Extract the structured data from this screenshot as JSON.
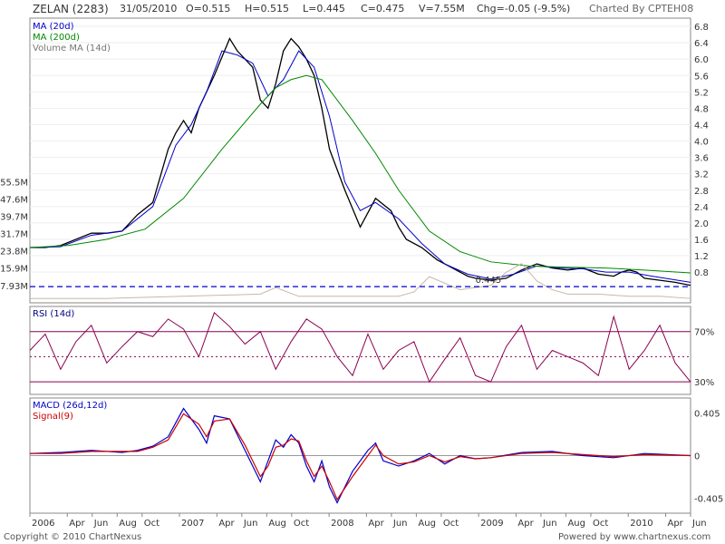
{
  "header": {
    "symbol": "ZELAN (2283)",
    "date": "31/05/2010",
    "open": "O=0.515",
    "high": "H=0.515",
    "low": "L=0.445",
    "close": "C=0.475",
    "volume": "V=7.55M",
    "change": "Chg=-0.05 (-9.5%)",
    "charted_by": "Charted By CPTEH08"
  },
  "footer": {
    "copyright": "Copyright © 2010 ChartNexus",
    "powered": "Powered by www.chartnexus.com"
  },
  "colors": {
    "price": "#000000",
    "ma20": "#0000cc",
    "ma200": "#008800",
    "volume": "#c8b8a8",
    "rsi": "#8b0050",
    "macd": "#0000cc",
    "signal": "#cc0000",
    "support": "#0000cc"
  },
  "chart_data": [
    {
      "type": "line",
      "panel": "price",
      "legend": [
        "MA (20d)",
        "MA (200d)",
        "Volume MA (14d)"
      ],
      "y_ticks": [
        "6.8",
        "6.4",
        "6.0",
        "5.6",
        "5.2",
        "4.8",
        "4.4",
        "4.0",
        "3.6",
        "3.2",
        "2.8",
        "2.4",
        "2.0",
        "1.6",
        "1.2",
        "0.8"
      ],
      "y_tick_values": [
        6.8,
        6.4,
        6.0,
        5.6,
        5.2,
        4.8,
        4.4,
        4.0,
        3.6,
        3.2,
        2.8,
        2.4,
        2.0,
        1.6,
        1.2,
        0.8
      ],
      "volume_ticks": [
        "55.5M",
        "47.6M",
        "39.7M",
        "31.7M",
        "23.8M",
        "15.9M",
        "7.93M"
      ],
      "volume_tick_values": [
        55.5,
        47.6,
        39.7,
        31.7,
        23.8,
        15.9,
        7.93
      ],
      "ylim": [
        0.05,
        7.0
      ],
      "support_label": "0.445",
      "support_value": 0.445,
      "series": [
        {
          "name": "Price",
          "x": [
            0,
            4,
            8,
            12,
            16,
            20,
            24,
            28,
            32,
            36,
            38,
            40,
            42,
            44,
            48,
            52,
            54,
            56,
            58,
            60,
            62,
            64,
            66,
            68,
            70,
            72,
            74,
            76,
            78,
            82,
            86,
            90,
            94,
            96,
            98,
            102,
            106,
            110,
            112,
            114,
            116,
            120,
            124,
            128,
            132,
            136,
            140,
            144,
            148,
            152,
            154,
            156,
            158,
            160,
            164,
            168,
            172
          ],
          "y": [
            1.4,
            1.4,
            1.45,
            1.6,
            1.75,
            1.75,
            1.8,
            2.2,
            2.5,
            3.8,
            4.2,
            4.5,
            4.2,
            4.8,
            5.6,
            6.5,
            6.2,
            6.0,
            5.8,
            5.0,
            4.8,
            5.4,
            6.2,
            6.5,
            6.3,
            6.0,
            5.6,
            4.8,
            3.8,
            2.8,
            1.9,
            2.6,
            2.3,
            1.9,
            1.6,
            1.4,
            1.1,
            0.9,
            0.8,
            0.7,
            0.65,
            0.6,
            0.65,
            0.85,
            1.0,
            0.9,
            0.85,
            0.9,
            0.75,
            0.7,
            0.8,
            0.85,
            0.8,
            0.65,
            0.6,
            0.55,
            0.475
          ]
        },
        {
          "name": "MA (20d)",
          "x": [
            0,
            8,
            16,
            24,
            32,
            38,
            42,
            46,
            50,
            54,
            58,
            62,
            66,
            70,
            74,
            78,
            82,
            86,
            90,
            96,
            102,
            108,
            114,
            120,
            126,
            132,
            138,
            144,
            150,
            156,
            162,
            172
          ],
          "y": [
            1.4,
            1.42,
            1.7,
            1.8,
            2.4,
            3.9,
            4.4,
            5.2,
            6.2,
            6.1,
            5.9,
            5.1,
            5.5,
            6.2,
            5.8,
            4.6,
            3.0,
            2.3,
            2.5,
            2.1,
            1.5,
            1.0,
            0.75,
            0.63,
            0.75,
            0.95,
            0.9,
            0.88,
            0.8,
            0.8,
            0.7,
            0.55
          ]
        },
        {
          "name": "MA (200d)",
          "x": [
            0,
            10,
            20,
            30,
            40,
            50,
            60,
            64,
            68,
            72,
            76,
            80,
            84,
            90,
            96,
            104,
            112,
            120,
            130,
            140,
            150,
            160,
            172
          ],
          "y": [
            1.4,
            1.45,
            1.6,
            1.85,
            2.6,
            3.8,
            4.9,
            5.3,
            5.5,
            5.6,
            5.5,
            5.0,
            4.5,
            3.7,
            2.8,
            1.8,
            1.3,
            1.05,
            0.95,
            0.92,
            0.9,
            0.85,
            0.78
          ]
        },
        {
          "name": "Volume MA (14d)",
          "x": [
            0,
            20,
            40,
            60,
            64,
            70,
            80,
            96,
            100,
            104,
            112,
            120,
            124,
            128,
            132,
            136,
            140,
            148,
            156,
            164,
            172
          ],
          "y": [
            2,
            2,
            3,
            4,
            7,
            3,
            3,
            3,
            5,
            12,
            6,
            8,
            14,
            18,
            10,
            6,
            4,
            4,
            3,
            3,
            2
          ]
        }
      ]
    },
    {
      "type": "line",
      "panel": "rsi",
      "legend": [
        "RSI (14d)"
      ],
      "levels": [
        70,
        30
      ],
      "level_labels": [
        "70%",
        "30%"
      ],
      "mid_level": 50,
      "ylim": [
        20,
        90
      ],
      "series": [
        {
          "name": "RSI (14d)",
          "x": [
            0,
            4,
            8,
            12,
            16,
            20,
            24,
            28,
            32,
            36,
            40,
            44,
            48,
            52,
            56,
            60,
            64,
            68,
            72,
            76,
            80,
            84,
            88,
            92,
            96,
            100,
            104,
            108,
            112,
            116,
            120,
            124,
            128,
            132,
            136,
            140,
            144,
            148,
            152,
            156,
            160,
            164,
            168,
            172
          ],
          "y": [
            55,
            68,
            40,
            62,
            75,
            45,
            58,
            70,
            66,
            80,
            72,
            50,
            85,
            74,
            60,
            70,
            40,
            62,
            80,
            72,
            50,
            35,
            68,
            40,
            55,
            62,
            30,
            48,
            65,
            35,
            30,
            58,
            75,
            40,
            55,
            50,
            45,
            35,
            82,
            40,
            55,
            75,
            45,
            30
          ]
        }
      ]
    },
    {
      "type": "line",
      "panel": "macd",
      "legend": [
        "MACD (26d,12d)",
        "Signal(9)"
      ],
      "y_ticks": [
        "0.405",
        "0",
        "-0.405"
      ],
      "y_tick_values": [
        0.405,
        0,
        -0.405
      ],
      "ylim": [
        -0.55,
        0.55
      ],
      "series": [
        {
          "name": "MACD (26d,12d)",
          "x": [
            0,
            8,
            16,
            24,
            28,
            32,
            36,
            40,
            44,
            46,
            48,
            52,
            56,
            58,
            60,
            62,
            64,
            66,
            68,
            70,
            72,
            74,
            76,
            78,
            80,
            84,
            88,
            90,
            92,
            96,
            100,
            104,
            108,
            112,
            116,
            120,
            128,
            136,
            144,
            152,
            160,
            172
          ],
          "y": [
            0.02,
            0.03,
            0.05,
            0.03,
            0.05,
            0.09,
            0.18,
            0.45,
            0.25,
            0.12,
            0.38,
            0.35,
            0.05,
            -0.1,
            -0.25,
            -0.05,
            0.15,
            0.08,
            0.2,
            0.12,
            -0.1,
            -0.25,
            -0.05,
            -0.3,
            -0.45,
            -0.15,
            0.05,
            0.12,
            -0.05,
            -0.1,
            -0.05,
            0.02,
            -0.08,
            0.0,
            -0.03,
            -0.02,
            0.03,
            0.04,
            0.0,
            -0.02,
            0.02,
            0.0
          ]
        },
        {
          "name": "Signal(9)",
          "x": [
            0,
            8,
            16,
            24,
            28,
            32,
            36,
            40,
            44,
            46,
            48,
            52,
            56,
            58,
            60,
            62,
            64,
            66,
            68,
            70,
            72,
            74,
            76,
            78,
            80,
            84,
            88,
            90,
            92,
            96,
            100,
            104,
            108,
            112,
            116,
            120,
            128,
            136,
            144,
            152,
            160,
            172
          ],
          "y": [
            0.02,
            0.02,
            0.04,
            0.04,
            0.04,
            0.08,
            0.15,
            0.4,
            0.3,
            0.18,
            0.33,
            0.35,
            0.1,
            -0.05,
            -0.2,
            -0.1,
            0.08,
            0.1,
            0.16,
            0.14,
            -0.05,
            -0.2,
            -0.1,
            -0.25,
            -0.42,
            -0.2,
            0.0,
            0.1,
            0.0,
            -0.08,
            -0.06,
            0.0,
            -0.06,
            -0.01,
            -0.03,
            -0.02,
            0.02,
            0.03,
            0.01,
            -0.01,
            0.01,
            0.0
          ]
        }
      ]
    },
    {
      "type": "axis",
      "panel": "x-axis",
      "x_ticks": [
        "2006",
        "Apr",
        "Jun",
        "Aug",
        "Oct",
        "2007",
        "Apr",
        "Jun",
        "Aug",
        "Oct",
        "2008",
        "Apr",
        "Jun",
        "Aug",
        "Oct",
        "2009",
        "Apr",
        "Jun",
        "Aug",
        "Oct",
        "2010",
        "Apr",
        "Jun"
      ],
      "x_tick_values": [
        0,
        6,
        10,
        14,
        18,
        24,
        30,
        34,
        38,
        42,
        48,
        54,
        58,
        62,
        66,
        72,
        78,
        82,
        86,
        90,
        96,
        102,
        106
      ],
      "x_scale_note": ""
    }
  ]
}
